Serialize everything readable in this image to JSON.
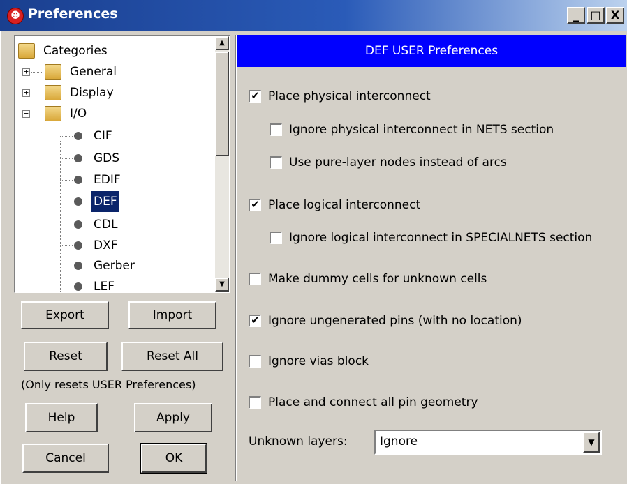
{
  "window": {
    "title": "Preferences",
    "minimize_label": "_",
    "maximize_label": "□",
    "close_label": "X"
  },
  "tree": {
    "root": "Categories",
    "items": [
      {
        "label": "General",
        "kind": "folder",
        "expander": "+"
      },
      {
        "label": "Display",
        "kind": "folder",
        "expander": "+"
      },
      {
        "label": "I/O",
        "kind": "folder",
        "expander": "−"
      },
      {
        "label": "CIF",
        "kind": "leaf"
      },
      {
        "label": "GDS",
        "kind": "leaf"
      },
      {
        "label": "EDIF",
        "kind": "leaf"
      },
      {
        "label": "DEF",
        "kind": "leaf",
        "selected": true
      },
      {
        "label": "CDL",
        "kind": "leaf"
      },
      {
        "label": "DXF",
        "kind": "leaf"
      },
      {
        "label": "Gerber",
        "kind": "leaf"
      },
      {
        "label": "LEF",
        "kind": "leaf"
      }
    ],
    "scroll_up": "▲",
    "scroll_down": "▼"
  },
  "buttons": {
    "export": "Export",
    "import": "Import",
    "reset": "Reset",
    "reset_all": "Reset All",
    "reset_note": "(Only resets USER Preferences)",
    "help": "Help",
    "apply": "Apply",
    "cancel": "Cancel",
    "ok": "OK"
  },
  "panel": {
    "header": "DEF USER Preferences",
    "options": [
      {
        "label": "Place physical interconnect",
        "checked": true
      },
      {
        "label": "Ignore physical  interconnect in NETS section",
        "checked": false
      },
      {
        "label": "Use pure-layer nodes instead of arcs",
        "checked": false
      },
      {
        "label": "Place logical interconnect",
        "checked": true
      },
      {
        "label": "Ignore logical interconnect in SPECIALNETS section",
        "checked": false
      },
      {
        "label": "Make dummy cells for unknown cells",
        "checked": false
      },
      {
        "label": "Ignore ungenerated pins (with no location)",
        "checked": true
      },
      {
        "label": "Ignore vias block",
        "checked": false
      },
      {
        "label": "Place and connect all pin geometry",
        "checked": false
      }
    ],
    "unknown_layers_label": "Unknown layers:",
    "unknown_layers_value": "Ignore",
    "dropdown_arrow": "▼"
  },
  "colors": {
    "header_bg": "#0000ff",
    "selection_bg": "#0a246a",
    "title_gradient_start": "#1a3f8f"
  }
}
